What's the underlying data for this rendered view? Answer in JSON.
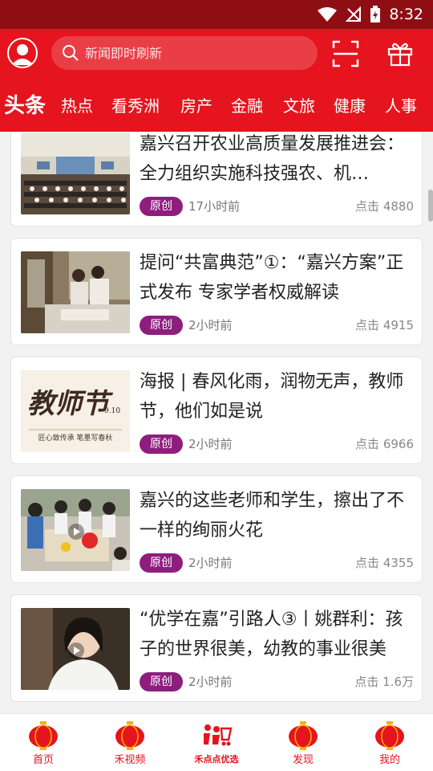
{
  "status_bar": {
    "time": "8:32"
  },
  "header": {
    "search_placeholder": "新闻即时刷新",
    "tabs": [
      "头条",
      "热点",
      "看秀洲",
      "房产",
      "金融",
      "文旅",
      "健康",
      "人事"
    ]
  },
  "articles": [
    {
      "title": "嘉兴召开农业高质量发展推进会：全力组织实施科技强农、机…",
      "badge": "原创",
      "time": "17小时前",
      "clicks": "点击 4880"
    },
    {
      "title": "提问“共富典范”①：“嘉兴方案”正式发布 专家学者权威解读",
      "badge": "原创",
      "time": "2小时前",
      "clicks": "点击 4915"
    },
    {
      "title": "海报 | 春风化雨，润物无声，教师节，他们如是说",
      "badge": "原创",
      "time": "2小时前",
      "clicks": "点击 6966",
      "thumb_text": {
        "main": "教师节",
        "date": "9.10",
        "caption": "匠心致传承 笔墨写春秋"
      }
    },
    {
      "title": "嘉兴的这些老师和学生，擦出了不一样的绚丽火花",
      "badge": "原创",
      "time": "2小时前",
      "clicks": "点击 4355"
    },
    {
      "title": "“优学在嘉”引路人③丨姚群利：孩子的世界很美，幼教的事业很美",
      "badge": "原创",
      "time": "2小时前",
      "clicks": "点击 1.6万"
    }
  ],
  "bottom_nav": [
    {
      "label": "首页",
      "icon": "lantern-icon"
    },
    {
      "label": "禾视频",
      "icon": "lantern-icon"
    },
    {
      "label": "禾点点优选",
      "icon": "shopping-cart-icon"
    },
    {
      "label": "发现",
      "icon": "lantern-icon"
    },
    {
      "label": "我的",
      "icon": "lantern-icon"
    }
  ],
  "colors": {
    "brand_red": "#e5141e",
    "status_bar": "#8f0e14",
    "badge_purple": "#8e1e7e"
  }
}
